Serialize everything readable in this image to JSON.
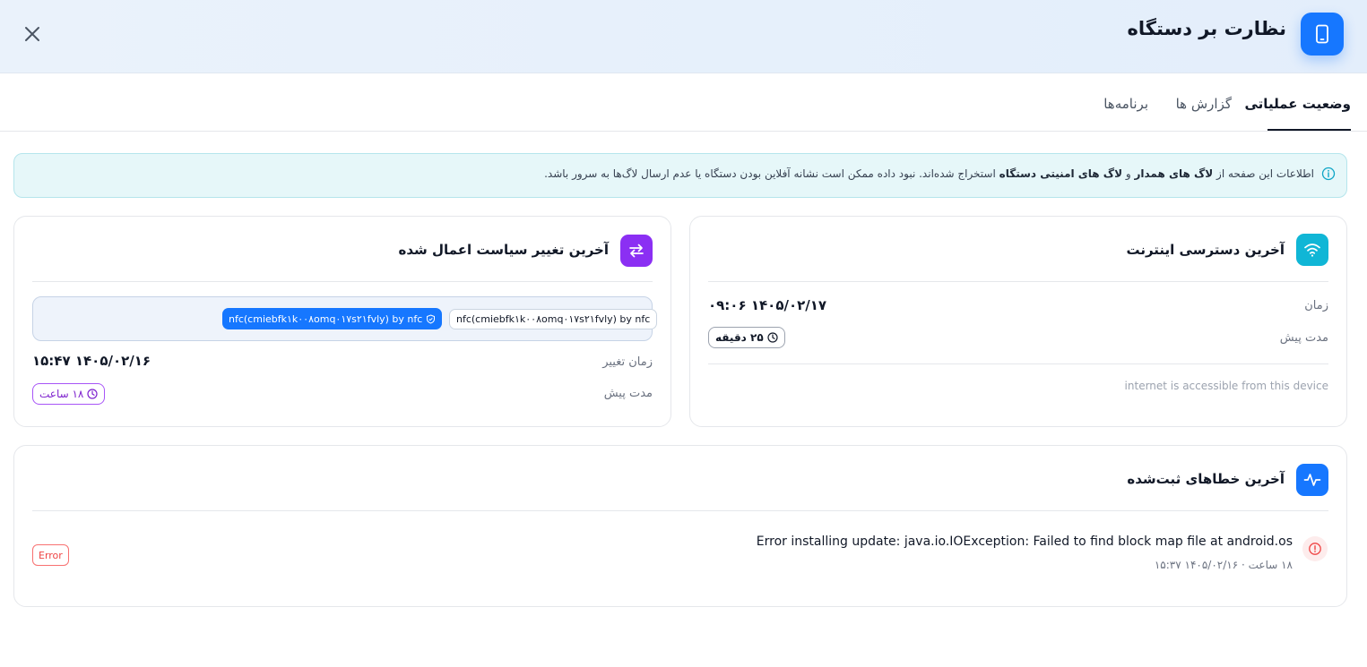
{
  "header": {
    "title": "نظارت بر دستگاه",
    "icon": "smartphone-icon"
  },
  "tabs": [
    {
      "label": "وضعیت عملیاتی",
      "active": true
    },
    {
      "label": "گزارش ها",
      "active": false
    },
    {
      "label": "برنامه‌ها",
      "active": false
    }
  ],
  "info": {
    "p1": "اطلاعات این صفحه از ",
    "b1": "لاگ های همدار",
    "p2": " و ",
    "b2": "لاگ های امنیتی دستگاه",
    "p3": " استخراج شده‌اند. نبود داده ممکن است نشانه آفلاین بودن دستگاه یا عدم ارسال لاگ‌ها به سرور باشد."
  },
  "internet_card": {
    "title": "آخرین دسترسی اینترنت",
    "time_label": "زمان",
    "time_value": "۱۴۰۵/۰۲/۱۷ ۰۹:۰۶",
    "ago_label": "مدت پیش",
    "ago_value": "۲۵ دقیقه",
    "note": "internet is accessible from this device"
  },
  "policy_card": {
    "title": "آخرین تغییر سیاست اعمال شده",
    "old_policy": "nfc(cmiebfk۱k۰۰۸omq۰۱۷s۲۱fvly) by nfc",
    "new_policy": "nfc(cmiebfk۱k۰۰۸omq۰۱۷s۲۱fvly) by nfc",
    "change_time_label": "زمان تغییر",
    "change_time_value": "۱۴۰۵/۰۲/۱۶ ۱۵:۴۷",
    "ago_label": "مدت پیش",
    "ago_value": "۱۸ ساعت"
  },
  "errors_card": {
    "title": "آخرین خطاهای ثبت‌شده",
    "items": [
      {
        "message": "Error installing update: java.io.IOException: Failed to find block map file at android.os",
        "ago": "۱۸ ساعت",
        "separator": "·",
        "timestamp": "۱۴۰۵/۰۲/۱۶ ۱۵:۳۷",
        "level": "Error"
      }
    ]
  },
  "colors": {
    "primary": "#1677ff",
    "internet_accent": "#10b6d6",
    "policy_accent": "#8b2ff3",
    "error": "#ef4444"
  }
}
